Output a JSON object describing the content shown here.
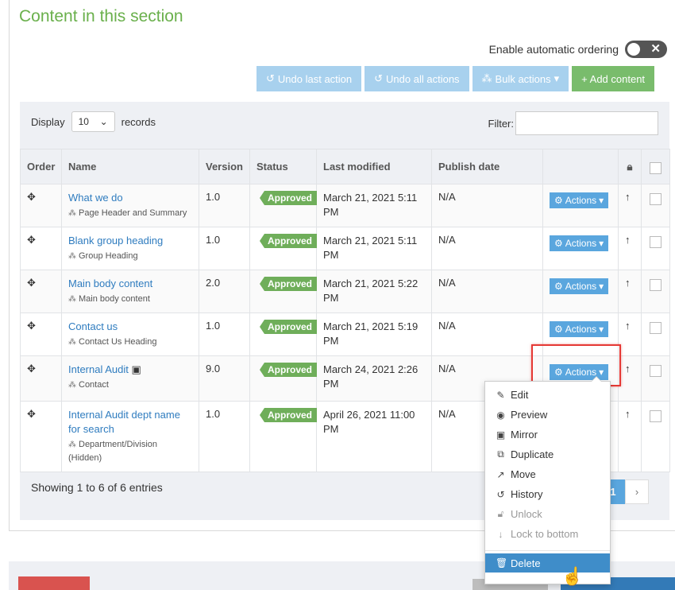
{
  "section_title": "Content in this section",
  "auto_ordering": {
    "label": "Enable automatic ordering",
    "icon": "x-icon"
  },
  "toolbar": {
    "undo_last": "Undo last action",
    "undo_all": "Undo all actions",
    "bulk": "Bulk actions",
    "add": "+ Add content"
  },
  "table_controls": {
    "display_label": "Display",
    "display_value": "10",
    "records_label": "records",
    "filter_label": "Filter:"
  },
  "columns": [
    "Order",
    "Name",
    "Version",
    "Status",
    "Last modified",
    "Publish date"
  ],
  "rows": [
    {
      "name": "What we do",
      "subtype": "Page Header and Summary",
      "version": "1.0",
      "status": "Approved",
      "modified": "March 21, 2021 5:11 PM",
      "publish": "N/A",
      "actions": "Actions"
    },
    {
      "name": "Blank group heading",
      "subtype": "Group Heading",
      "version": "1.0",
      "status": "Approved",
      "modified": "March 21, 2021 5:11 PM",
      "publish": "N/A",
      "actions": "Actions"
    },
    {
      "name": "Main body content",
      "subtype": "Main body content",
      "version": "2.0",
      "status": "Approved",
      "modified": "March 21, 2021 5:22 PM",
      "publish": "N/A",
      "actions": "Actions"
    },
    {
      "name": "Contact us",
      "subtype": "Contact Us Heading",
      "version": "1.0",
      "status": "Approved",
      "modified": "March 21, 2021 5:19 PM",
      "publish": "N/A",
      "actions": "Actions"
    },
    {
      "name": "Internal Audit",
      "subtype": "Contact",
      "version": "9.0",
      "status": "Approved",
      "modified": "March 24, 2021 2:26 PM",
      "publish": "N/A",
      "actions": "Actions"
    },
    {
      "name": "Internal Audit dept name for search",
      "subtype": "Department/Division",
      "subtype_note": "(Hidden)",
      "version": "1.0",
      "status": "Approved",
      "modified": "April 26, 2021 11:00 PM",
      "publish": "N/A"
    }
  ],
  "footer": {
    "info": "Showing 1 to 6 of 6 entries",
    "page": "1",
    "next": "›"
  },
  "dropdown": {
    "items": [
      {
        "label": "Edit",
        "icon": "edit-icon"
      },
      {
        "label": "Preview",
        "icon": "eye-icon"
      },
      {
        "label": "Mirror",
        "icon": "mirror-icon"
      },
      {
        "label": "Duplicate",
        "icon": "duplicate-icon"
      },
      {
        "label": "Move",
        "icon": "external-link-icon"
      },
      {
        "label": "History",
        "icon": "history-icon"
      },
      {
        "label": "Unlock",
        "icon": "unlock-icon"
      },
      {
        "label": "Lock to bottom",
        "icon": "arrow-down-icon"
      },
      {
        "label": "Delete",
        "icon": "trash-icon"
      }
    ]
  },
  "colors": {
    "accent_green": "#6ab04c",
    "approved": "#6fae5a",
    "action_blue": "#5aa6de",
    "highlight_red": "#e53935"
  }
}
